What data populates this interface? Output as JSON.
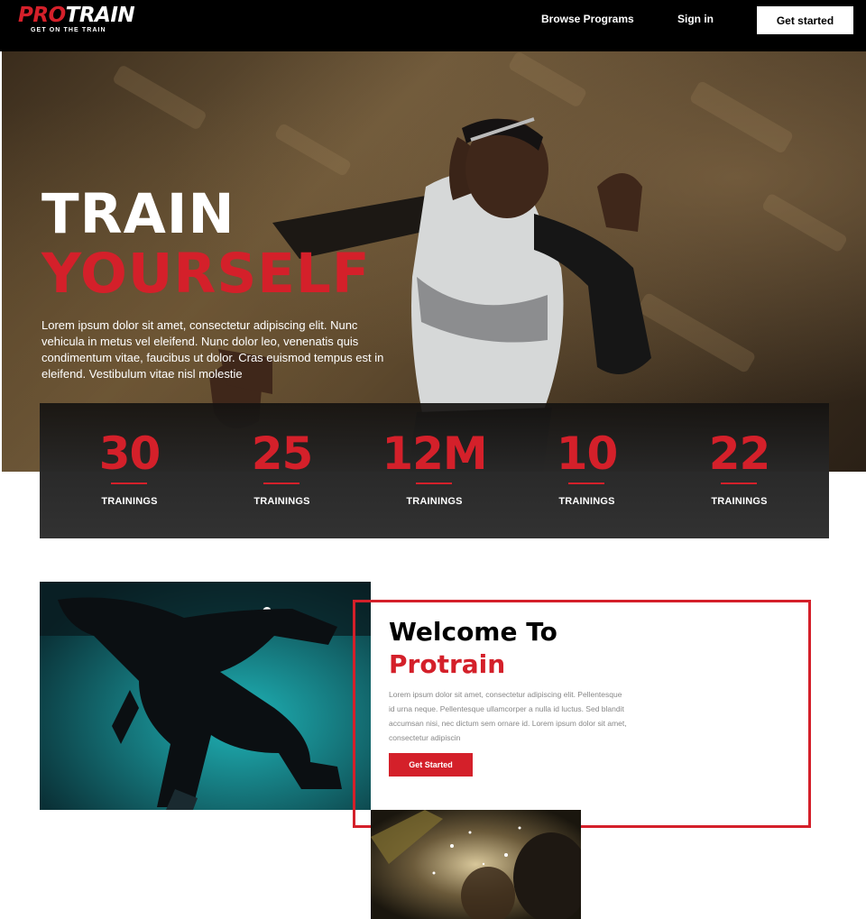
{
  "nav": {
    "logo_main_pro": "PRO",
    "logo_main_train": "TRAIN",
    "logo_tagline": "GET ON THE TRAIN",
    "browse_label": "Browse Programs",
    "signin_label": "Sign in",
    "cta_label": "Get started"
  },
  "hero": {
    "title_line1": "TRAIN",
    "title_line2": "YOURSELF",
    "body": "Lorem ipsum dolor sit amet, consectetur adipiscing elit. Nunc vehicula in metus vel eleifend. Nunc dolor leo, venenatis quis condimentum vitae, faucibus ut dolor. Cras euismod tempus est in eleifend. Vestibulum vitae nisl molestie"
  },
  "stats": [
    {
      "value": "30",
      "label": "TRAININGS"
    },
    {
      "value": "25",
      "label": "TRAININGS"
    },
    {
      "value": "12M",
      "label": "TRAININGS"
    },
    {
      "value": "10",
      "label": "TRAININGS"
    },
    {
      "value": "22",
      "label": "TRAININGS"
    }
  ],
  "welcome": {
    "title_line1": "Welcome To",
    "title_line2": "Protrain",
    "body": "Lorem ipsum dolor sit amet, consectetur adipiscing elit. Pellentesque id urna neque. Pellentesque ullamcorper a nulla id luctus. Sed blandit accumsan nisi, nec dictum sem ornare id. Lorem ipsum dolor sit amet, consectetur adipiscin",
    "cta_label": "Get Started"
  },
  "colors": {
    "accent": "#d4202a",
    "nav_bg": "#000000",
    "stats_bg": "#2b2b2b"
  }
}
